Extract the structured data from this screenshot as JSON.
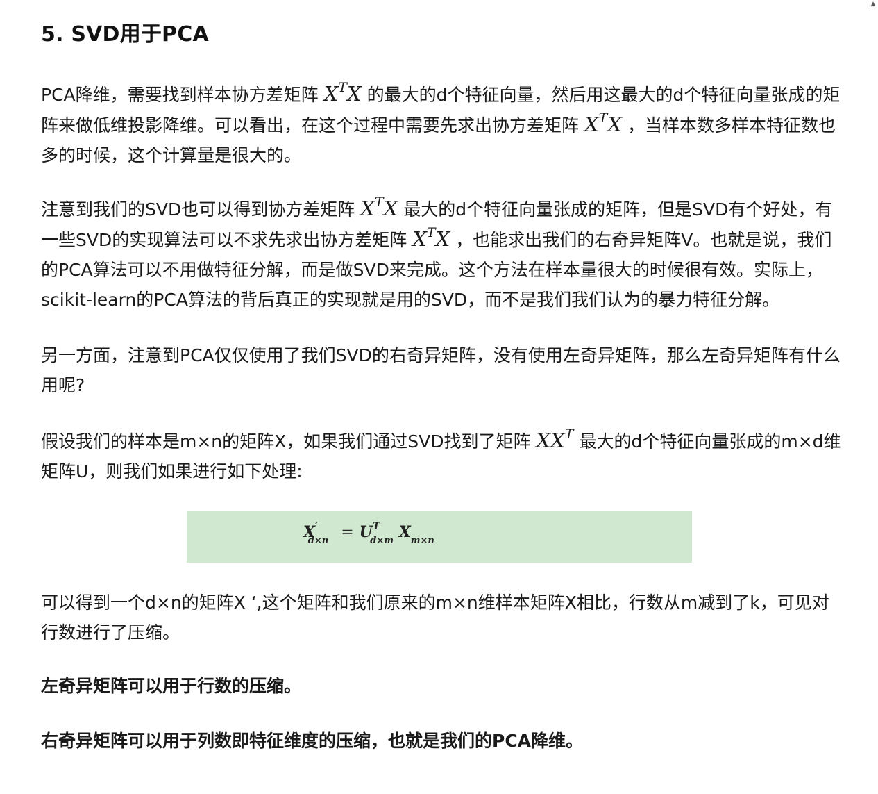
{
  "heading": "5. SVD用于PCA",
  "math": {
    "xtx_base": "X",
    "xtx_sup": "T",
    "xtx_tail": "X",
    "xxt_base": "XX",
    "xxt_sup": "T"
  },
  "p1": {
    "a": "PCA降维，需要找到样本协方差矩阵",
    "b": "的最大的d个特征向量，然后用这最大的d个特征向量张成的矩阵来做低维投影降维。可以看出，在这个过程中需要先求出协方差矩阵",
    "c": "，当样本数多样本特征数也多的时候，这个计算量是很大的。"
  },
  "p2": {
    "a": "注意到我们的SVD也可以得到协方差矩阵",
    "b": "最大的d个特征向量张成的矩阵，但是SVD有个好处，有一些SVD的实现算法可以不求先求出协方差矩阵",
    "c": "，也能求出我们的右奇异矩阵V。也就是说，我们的PCA算法可以不用做特征分解，而是做SVD来完成。这个方法在样本量很大的时候很有效。实际上，scikit-learn的PCA算法的背后真正的实现就是用的SVD，而不是我们我们认为的暴力特征分解。"
  },
  "p3": "另一方面，注意到PCA仅仅使用了我们SVD的右奇异矩阵，没有使用左奇异矩阵，那么左奇异矩阵有什么用呢?",
  "p4": {
    "a": "假设我们的样本是m×n的矩阵X，如果我们通过SVD找到了矩阵",
    "b": "最大的d个特征向量张成的m×d维矩阵U，则我们如果进行如下处理:"
  },
  "formula": {
    "lhs": "X",
    "lhs_prime": "′",
    "lhs_sub": "d×n",
    "eq": "=",
    "u": "U",
    "u_sup": "T",
    "u_sub": "d×m",
    "x": "X",
    "x_sub": "m×n"
  },
  "p5": "可以得到一个d×n的矩阵X ‘,这个矩阵和我们原来的m×n维样本矩阵X相比，行数从m减到了k，可见对行数进行了压缩。",
  "p6": "左奇异矩阵可以用于行数的压缩。",
  "p7": "右奇异矩阵可以用于列数即特征维度的压缩，也就是我们的PCA降维。",
  "scrollbar": {
    "up_arrow": "▲"
  }
}
